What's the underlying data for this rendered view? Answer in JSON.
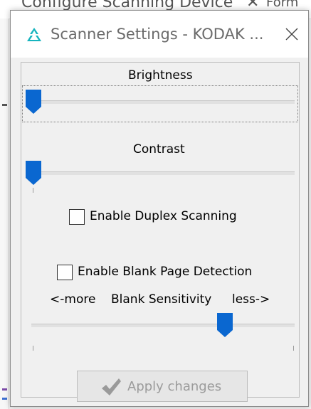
{
  "background_window": {
    "title": "Configure Scanning Device",
    "extra": "Form"
  },
  "dialog": {
    "title": "Scanner Settings - KODAK ...",
    "icons": {
      "app": "scanner-app-icon",
      "close": "close-icon"
    },
    "brightness": {
      "label": "Brightness",
      "value": 0
    },
    "contrast": {
      "label": "Contrast",
      "value": 0
    },
    "duplex": {
      "label": "Enable Duplex Scanning",
      "checked": false
    },
    "blank_detection": {
      "label": "Enable Blank Page Detection",
      "checked": false
    },
    "blank_sensitivity": {
      "left_label": "<-more",
      "label": "Blank Sensitivity",
      "right_label": "less->",
      "value": 0.75
    },
    "apply": {
      "label": "Apply changes",
      "enabled": false
    }
  },
  "colors": {
    "accent": "#0a67d0",
    "icon_teal": "#17b4be",
    "disabled_text": "#9b9b9b"
  }
}
